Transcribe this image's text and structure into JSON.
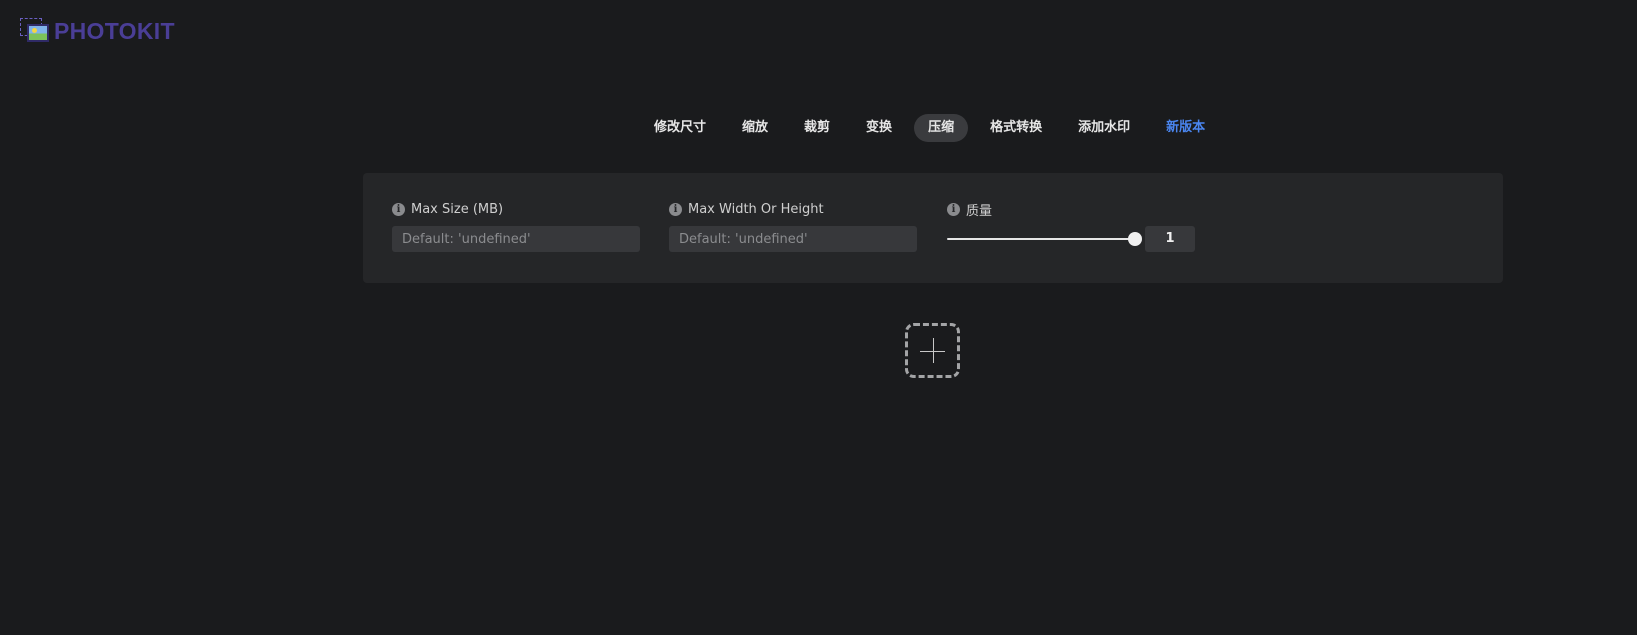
{
  "brand": {
    "name": "PHOTOKIT",
    "icon": "photo-icon",
    "color": "#4a3e96"
  },
  "tabs": [
    {
      "label": "修改尺寸"
    },
    {
      "label": "缩放"
    },
    {
      "label": "裁剪"
    },
    {
      "label": "变换"
    },
    {
      "label": "压缩",
      "active": true
    },
    {
      "label": "格式转换"
    },
    {
      "label": "添加水印"
    },
    {
      "label": "新版本",
      "accent": "#4a86f0"
    }
  ],
  "options": {
    "max_size": {
      "label": "Max Size (MB)",
      "placeholder": "Default: 'undefined'",
      "value": "",
      "icon": "info-icon"
    },
    "max_width_height": {
      "label": "Max Width Or Height",
      "placeholder": "Default: 'undefined'",
      "value": "",
      "icon": "info-icon"
    },
    "quality": {
      "label": "质量",
      "value": "1",
      "slider_fraction": 1.0,
      "icon": "info-icon"
    }
  },
  "upload": {
    "icon": "plus-icon"
  }
}
